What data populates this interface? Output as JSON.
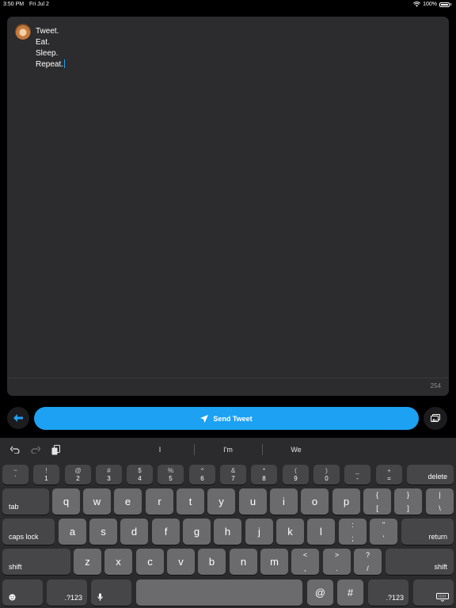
{
  "status": {
    "time": "3:50 PM",
    "date": "Fri Jul 2",
    "battery": "100%"
  },
  "compose": {
    "lines": [
      "Tweet.",
      "Eat.",
      "Sleep.",
      "Repeat."
    ],
    "char_count": "254"
  },
  "actions": {
    "send_label": "Send Tweet"
  },
  "suggestions": [
    "I",
    "I'm",
    "We"
  ],
  "keys": {
    "num": [
      {
        "top": "~",
        "bot": "`"
      },
      {
        "top": "!",
        "bot": "1"
      },
      {
        "top": "@",
        "bot": "2"
      },
      {
        "top": "#",
        "bot": "3"
      },
      {
        "top": "$",
        "bot": "4"
      },
      {
        "top": "%",
        "bot": "5"
      },
      {
        "top": "^",
        "bot": "6"
      },
      {
        "top": "&",
        "bot": "7"
      },
      {
        "top": "*",
        "bot": "8"
      },
      {
        "top": "(",
        "bot": "9"
      },
      {
        "top": ")",
        "bot": "0"
      },
      {
        "top": "_",
        "bot": "-"
      },
      {
        "top": "+",
        "bot": "="
      }
    ],
    "delete": "delete",
    "tab": "tab",
    "row1": [
      "q",
      "w",
      "e",
      "r",
      "t",
      "y",
      "u",
      "i",
      "o",
      "p"
    ],
    "row1_sym": [
      {
        "top": "{",
        "bot": "["
      },
      {
        "top": "}",
        "bot": "]"
      },
      {
        "top": "|",
        "bot": "\\"
      }
    ],
    "caps": "caps lock",
    "row2": [
      "a",
      "s",
      "d",
      "f",
      "g",
      "h",
      "j",
      "k",
      "l"
    ],
    "row2_sym": [
      {
        "top": ":",
        "bot": ";"
      },
      {
        "top": "\"",
        "bot": "'"
      }
    ],
    "return": "return",
    "shift": "shift",
    "row3": [
      "z",
      "x",
      "c",
      "v",
      "b",
      "n",
      "m"
    ],
    "row3_sym": [
      {
        "top": "<",
        "bot": ","
      },
      {
        "top": ">",
        "bot": "."
      },
      {
        "top": "?",
        "bot": "/"
      }
    ],
    "numbers_mode": ".?123",
    "at": "@",
    "hash": "#"
  },
  "colors": {
    "accent": "#1da1f2",
    "card": "#2c2c2e",
    "keyboard": "#2b2b2d"
  }
}
